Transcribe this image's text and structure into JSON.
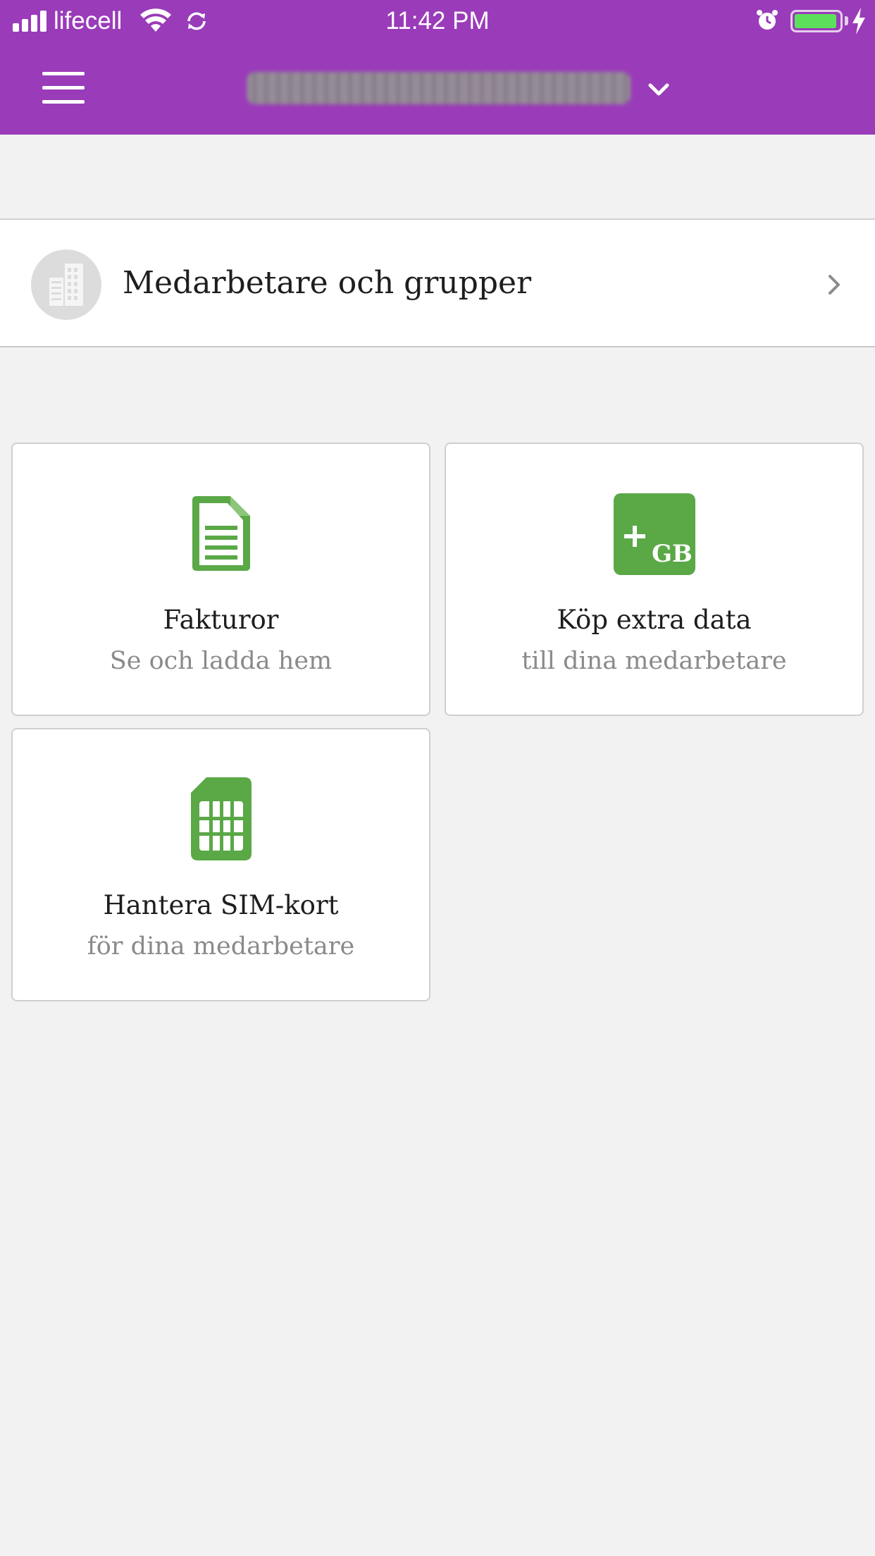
{
  "status_bar": {
    "carrier": "lifecell",
    "time": "11:42 PM",
    "battery_level": 0.95
  },
  "nav": {
    "account_name": ""
  },
  "employees_row": {
    "label": "Medarbetare och grupper"
  },
  "tiles": [
    {
      "title": "Fakturor",
      "subtitle": "Se och ladda hem",
      "icon": "document-icon"
    },
    {
      "title": "Köp extra data",
      "subtitle": "till dina medarbetare",
      "icon": "extra-data-gb-icon",
      "icon_text": "GB"
    },
    {
      "title": "Hantera SIM-kort",
      "subtitle": "för dina medarbetare",
      "icon": "sim-card-icon"
    }
  ],
  "colors": {
    "header_bg": "#9a3bb9",
    "page_bg": "#f2f2f2",
    "icon_green": "#5aa846"
  }
}
